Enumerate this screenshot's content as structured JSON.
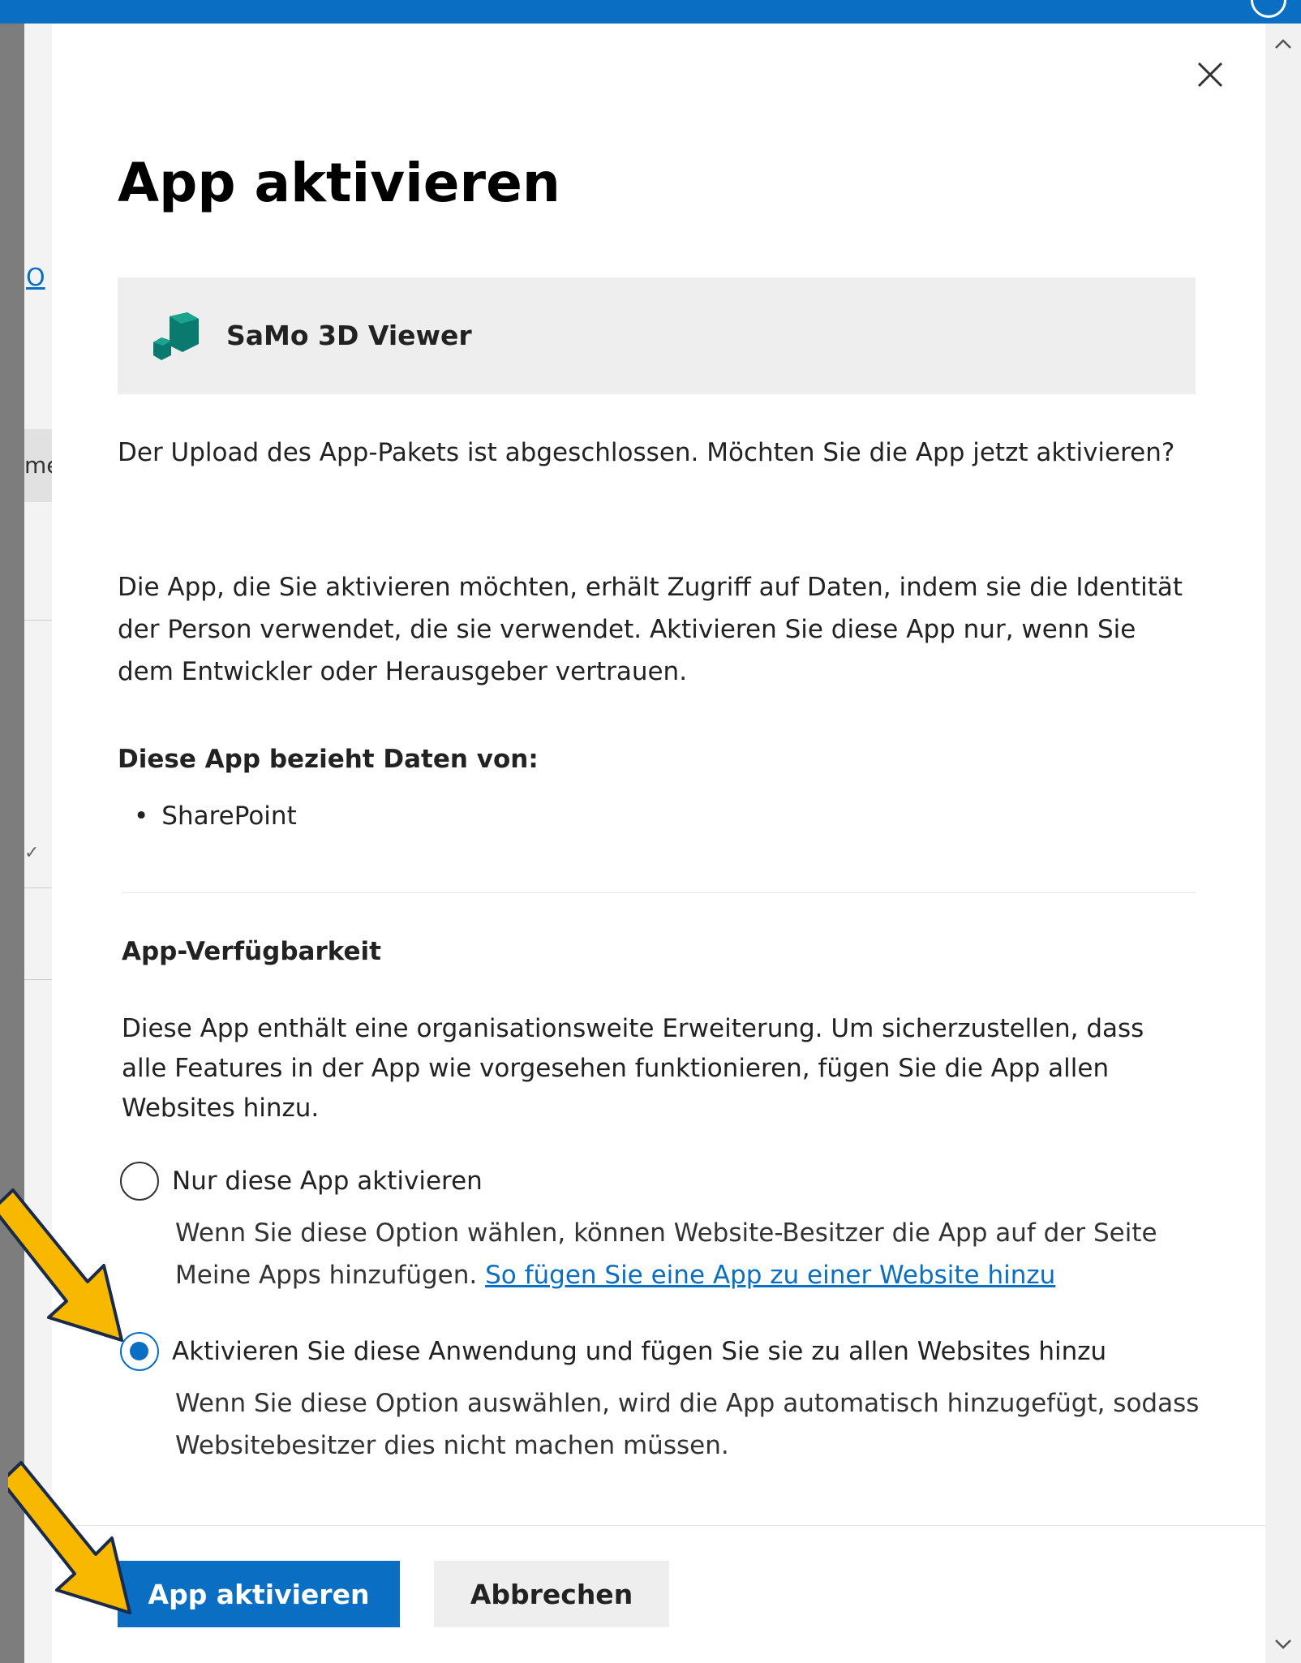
{
  "dialog": {
    "title": "App aktivieren",
    "app_name": "SaMo 3D Viewer",
    "intro": "Der Upload des App-Pakets ist abgeschlossen. Möchten Sie die App jetzt aktivieren?",
    "warning": "Die App, die Sie aktivieren möchten, erhält Zugriff auf Daten, indem sie die Identität der Person verwendet, die sie verwendet. Aktivieren Sie diese App nur, wenn Sie dem Entwickler oder Herausgeber vertrauen.",
    "data_sources_heading": "Diese App bezieht Daten von:",
    "data_sources": [
      "SharePoint"
    ],
    "availability": {
      "heading": "App-Verfügbarkeit",
      "description": "Diese App enthält eine organisationsweite Erweiterung. Um sicherzustellen, dass alle Features in der App wie vorgesehen funktionieren, fügen Sie die App allen Websites hinzu.",
      "options": [
        {
          "label": "Nur diese App aktivieren",
          "description": "Wenn Sie diese Option wählen, können Website-Besitzer die App auf der Seite Meine Apps hinzufügen.",
          "link_text": "So fügen Sie eine App zu einer Website hinzu",
          "selected": false
        },
        {
          "label": "Aktivieren Sie diese Anwendung und fügen Sie sie zu allen Websites hinzu",
          "description": "Wenn Sie diese Option auswählen, wird die App automatisch hinzugefügt, sodass Websitebesitzer dies nicht machen müssen.",
          "selected": true
        }
      ]
    },
    "buttons": {
      "primary": "App aktivieren",
      "cancel": "Abbrechen"
    }
  },
  "background": {
    "link_fragment": "O",
    "text_fragment": "me"
  },
  "icons": {
    "close": "close-icon",
    "app": "cube-icon",
    "scroll_up": "chevron-up-icon",
    "scroll_down": "chevron-down-icon",
    "annotation": "arrow-icon"
  },
  "colors": {
    "accent": "#0a6fc2",
    "annotation_arrow": "#f9b800",
    "app_icon": "#0b7a6e"
  }
}
